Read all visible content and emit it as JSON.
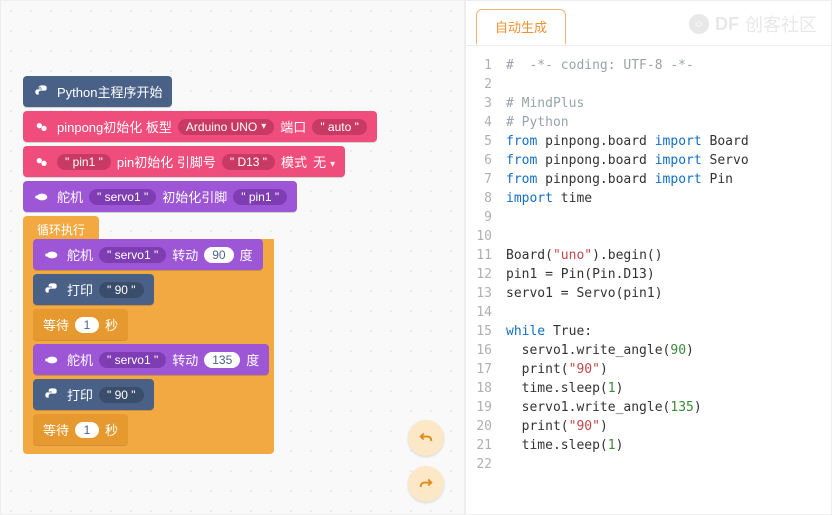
{
  "blocks": {
    "main_start": "Python主程序开始",
    "init_board_prefix": "pinpong初始化 板型",
    "board_name": "Arduino UNO",
    "port_label": "端口",
    "port_value": "\" auto \"",
    "pin_name": "\" pin1 \"",
    "pin_init_text": "pin初始化 引脚号",
    "pin_number": "\" D13 \"",
    "mode_label": "模式",
    "mode_value": "无",
    "servo_label": "舵机",
    "servo_name": "\" servo1 \"",
    "servo_init_text": "初始化引脚",
    "servo_init_pin": "\" pin1 \"",
    "loop_head": "循环执行",
    "rotate_label": "转动",
    "degree_unit": "度",
    "rotate_val_90": "90",
    "rotate_val_135": "135",
    "print_label": "打印",
    "print_value": "\" 90 \"",
    "wait_label": "等待",
    "wait_value": "1",
    "wait_unit": "秒"
  },
  "right": {
    "tab_auto": "自动生成",
    "watermark_badge": "DF",
    "watermark_text": "创客社区"
  },
  "code": [
    {
      "n": 1,
      "c": "comment",
      "t": "#  -*- coding: UTF-8 -*-"
    },
    {
      "n": 2,
      "c": "",
      "t": ""
    },
    {
      "n": 3,
      "c": "comment",
      "t": "# MindPlus"
    },
    {
      "n": 4,
      "c": "comment",
      "t": "# Python"
    },
    {
      "n": 5,
      "c": "import",
      "pre": "from ",
      "mod": "pinpong.board",
      "mid": " import ",
      "name": "Board"
    },
    {
      "n": 6,
      "c": "import",
      "pre": "from ",
      "mod": "pinpong.board",
      "mid": " import ",
      "name": "Servo"
    },
    {
      "n": 7,
      "c": "import",
      "pre": "from ",
      "mod": "pinpong.board",
      "mid": " import ",
      "name": "Pin"
    },
    {
      "n": 8,
      "c": "import2",
      "pre": "import ",
      "mod": "time"
    },
    {
      "n": 9,
      "c": "",
      "t": ""
    },
    {
      "n": 10,
      "c": "",
      "t": ""
    },
    {
      "n": 11,
      "c": "call",
      "t1": "Board(",
      "s": "\"uno\"",
      "t2": ").begin()"
    },
    {
      "n": 12,
      "c": "plain",
      "t": "pin1 = Pin(Pin.D13)"
    },
    {
      "n": 13,
      "c": "plain",
      "t": "servo1 = Servo(pin1)"
    },
    {
      "n": 14,
      "c": "",
      "t": ""
    },
    {
      "n": 15,
      "c": "while",
      "kw": "while",
      "cond": " True:"
    },
    {
      "n": 16,
      "c": "call",
      "indent": "  ",
      "t1": "servo1.write_angle(",
      "nmv": "90",
      "t2": ")"
    },
    {
      "n": 17,
      "c": "call",
      "indent": "  ",
      "t1": "print(",
      "s": "\"90\"",
      "t2": ")"
    },
    {
      "n": 18,
      "c": "call",
      "indent": "  ",
      "t1": "time.sleep(",
      "nmv": "1",
      "t2": ")"
    },
    {
      "n": 19,
      "c": "call",
      "indent": "  ",
      "t1": "servo1.write_angle(",
      "nmv": "135",
      "t2": ")"
    },
    {
      "n": 20,
      "c": "call",
      "indent": "  ",
      "t1": "print(",
      "s": "\"90\"",
      "t2": ")"
    },
    {
      "n": 21,
      "c": "call",
      "indent": "  ",
      "t1": "time.sleep(",
      "nmv": "1",
      "t2": ")"
    },
    {
      "n": 22,
      "c": "",
      "t": ""
    }
  ]
}
